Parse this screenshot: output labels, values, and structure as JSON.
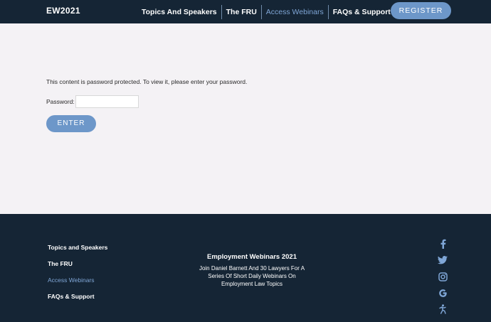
{
  "header": {
    "logo": "EW2021",
    "nav": [
      {
        "label": "Topics And Speakers",
        "active": false
      },
      {
        "label": "The FRU",
        "active": false
      },
      {
        "label": "Access Webinars",
        "active": true
      },
      {
        "label": "FAQs & Support",
        "active": false
      }
    ],
    "register_label": "REGISTER"
  },
  "main": {
    "notice": "This content is password protected. To view it, please enter your password.",
    "password_label": "Password:",
    "password_value": "",
    "enter_label": "ENTER"
  },
  "footer": {
    "links": [
      {
        "label": "Topics and Speakers",
        "active": false
      },
      {
        "label": "The FRU",
        "active": false
      },
      {
        "label": "Access Webinars",
        "active": true
      },
      {
        "label": "FAQs & Support",
        "active": false
      }
    ],
    "title": "Employment Webinars 2021",
    "description": "Join Daniel Barnett And 30 Lawyers For A Series Of Short Daily Webinars On Employment Law Topics",
    "social_icons": [
      "facebook-icon",
      "twitter-icon",
      "instagram-icon",
      "google-icon",
      "accessibility-icon"
    ]
  },
  "colors": {
    "navy": "#152535",
    "accent": "#6d97c9",
    "active_link": "#7fa6d6",
    "background": "#f4f2f5"
  }
}
